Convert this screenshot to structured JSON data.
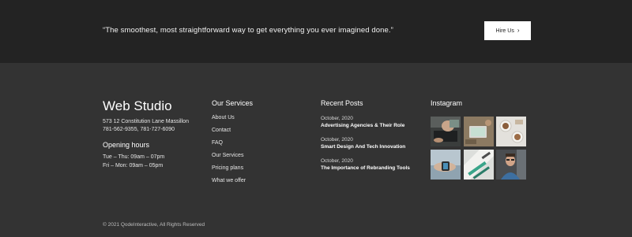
{
  "cta": {
    "quote": "“The smoothest, most straightforward way to get everything you ever imagined done.”",
    "button_label": "Hire Us",
    "button_icon": "chevron-right-icon"
  },
  "footer": {
    "brand": "Web Studio",
    "address_line1": "573 12 Constitution Lane Massillon",
    "address_line2": "781-562-9355,  781-727-6090",
    "hours_title": "Opening hours",
    "hours_line1": "Tue – Thu: 09am – 07pm",
    "hours_line2": "Fri – Mon: 09am – 05pm",
    "services_title": "Our Services",
    "services": [
      "About Us",
      "Contact",
      "FAQ",
      "Our Services",
      "Pricing plans",
      "What we offer"
    ],
    "posts_title": "Recent Posts",
    "posts": [
      {
        "date": "October, 2020",
        "title": "Advertising Agencies & Their Role"
      },
      {
        "date": "October, 2020",
        "title": "Smart Design And Tech Innovation"
      },
      {
        "date": "October, 2020",
        "title": "The Importance of Rebranding Tools"
      }
    ],
    "instagram_title": "Instagram",
    "instagram_images": [
      "laptop-hands-photo",
      "tablet-desk-photo",
      "coffee-cups-photo",
      "smartwatch-photo",
      "drawing-tools-photo",
      "man-glasses-photo"
    ],
    "copyright": "© 2021 QodeInteractive, All Rights Reserved"
  },
  "colors": {
    "cta_bg": "#232323",
    "footer_bg": "#333333",
    "button_bg": "#ffffff"
  }
}
